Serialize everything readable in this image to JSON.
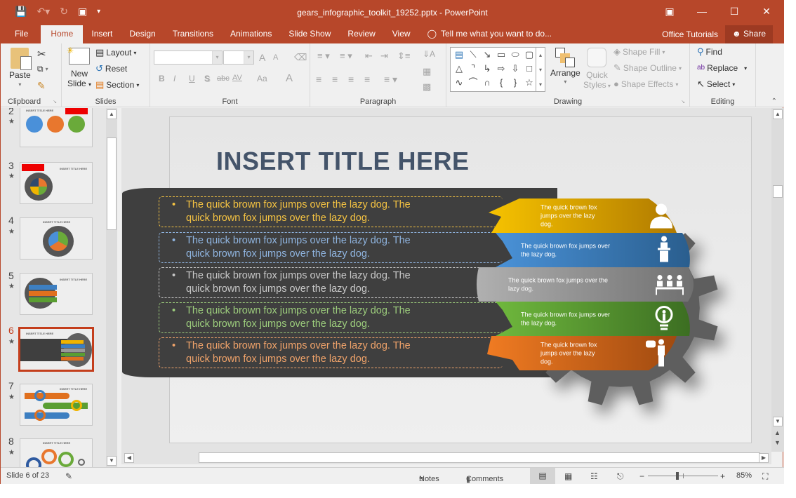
{
  "window": {
    "title": "gears_infographic_toolkit_19252.pptx - PowerPoint",
    "controls": [
      "ribbon-display-icon",
      "minimize-icon",
      "maximize-icon",
      "close-icon"
    ]
  },
  "qat": {
    "save": "save-icon",
    "undo": "undo-icon",
    "redo": "redo-icon",
    "present": "present-from-start-icon",
    "customize": "customize-qat-icon"
  },
  "tabs": [
    {
      "label": "File"
    },
    {
      "label": "Home",
      "active": true
    },
    {
      "label": "Insert"
    },
    {
      "label": "Design"
    },
    {
      "label": "Transitions"
    },
    {
      "label": "Animations"
    },
    {
      "label": "Slide Show"
    },
    {
      "label": "Review"
    },
    {
      "label": "View"
    }
  ],
  "tell_me": "Tell me what you want to do...",
  "office_tutorials": "Office Tutorials",
  "share": "Share",
  "ribbon": {
    "clipboard": {
      "label": "Clipboard",
      "paste": "Paste"
    },
    "slides": {
      "label": "Slides",
      "new_slide_1": "New",
      "new_slide_2": "Slide",
      "layout": "Layout",
      "reset": "Reset",
      "section": "Section"
    },
    "font": {
      "label": "Font",
      "font_name": "",
      "font_size": "",
      "bold": "B",
      "italic": "I",
      "underline": "U",
      "shadow": "S",
      "strike": "abc",
      "spacing": "AV",
      "case": "Aa",
      "color": "A",
      "grow": "A",
      "shrink": "A"
    },
    "paragraph": {
      "label": "Paragraph"
    },
    "drawing": {
      "label": "Drawing",
      "arrange": "Arrange",
      "quick_styles_1": "Quick",
      "quick_styles_2": "Styles",
      "shape_fill": "Shape Fill",
      "shape_outline": "Shape Outline",
      "shape_effects": "Shape Effects"
    },
    "editing": {
      "label": "Editing",
      "find": "Find",
      "replace": "Replace",
      "select": "Select"
    }
  },
  "thumbnails": [
    {
      "num": "2",
      "title": "INSERT TITLE HERE"
    },
    {
      "num": "3",
      "title": "INSERT TITLE HERE"
    },
    {
      "num": "4",
      "title": "INSERT TITLE HERE"
    },
    {
      "num": "5",
      "title": "INSERT TITLE HERE"
    },
    {
      "num": "6",
      "title": "INSERT TITLE HERE",
      "selected": true
    },
    {
      "num": "7",
      "title": "INSERT TITLE HERE"
    },
    {
      "num": "8",
      "title": "INSERT TITLE HERE"
    }
  ],
  "slide": {
    "title": "INSERT TITLE HERE",
    "bullets": [
      {
        "line1": "The quick brown fox jumps over the lazy dog. The",
        "line2": "quick brown fox jumps over the lazy dog.",
        "color": "#f5c342"
      },
      {
        "line1": "The quick brown fox jumps over the lazy dog. The",
        "line2": "quick brown fox jumps over the lazy dog.",
        "color": "#8fb4df"
      },
      {
        "line1": "The quick brown fox jumps over the lazy dog. The",
        "line2": "quick brown fox jumps over the lazy dog.",
        "color": "#c8c8c8"
      },
      {
        "line1": "The quick brown fox jumps over the lazy dog. The",
        "line2": "quick brown fox jumps over the lazy dog.",
        "color": "#9ccc7c"
      },
      {
        "line1": "The quick brown fox jumps over the lazy dog. The",
        "line2": "quick brown fox jumps over the lazy dog.",
        "color": "#f0a36a"
      }
    ],
    "bands": [
      {
        "text": "The quick brown fox jumps over the lazy dog.",
        "icon": "businessman-icon",
        "color": "#f0b400"
      },
      {
        "text": "The quick brown fox jumps over the lazy dog.",
        "icon": "speaker-podium-icon",
        "color": "#3d7fc1"
      },
      {
        "text": "The quick brown fox jumps over the lazy dog.",
        "icon": "meeting-icon",
        "color": "#8a8a8a"
      },
      {
        "text": "The quick brown fox jumps over the lazy dog.",
        "icon": "lightbulb-icon",
        "color": "#5a9e32"
      },
      {
        "text": "The quick brown fox jumps over the lazy dog.",
        "icon": "speech-person-icon",
        "color": "#e0701e"
      }
    ]
  },
  "status": {
    "slide_info": "Slide 6 of 23",
    "notes": "Notes",
    "comments": "Comments",
    "zoom": "85%",
    "zoom_level_percent": 85
  }
}
